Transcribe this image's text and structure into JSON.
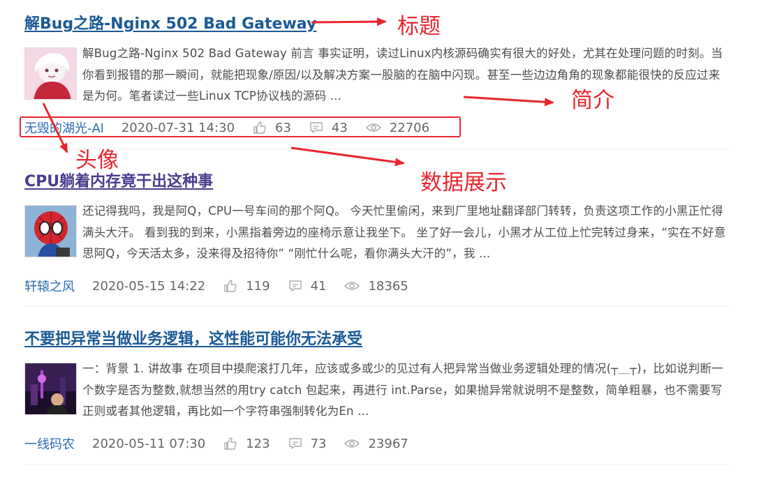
{
  "posts": [
    {
      "title": "解Bug之路-Nginx 502 Bad Gateway",
      "summary": "解Bug之路-Nginx 502 Bad Gateway 前言 事实证明，读过Linux内核源码确实有很大的好处，尤其在处理问题的时刻。当你看到报错的那一瞬间，就能把现象/原因/以及解决方案一股脑的在脑中闪现。甚至一些边边角角的现象都能很快的反应过来是为何。笔者读过一些Linux TCP协议栈的源码 ...",
      "author": "无毁的湖光-Al",
      "date": "2020-07-31 14:30",
      "likes": "63",
      "comments": "43",
      "views": "22706"
    },
    {
      "title": "CPU躺着内存竟干出这种事",
      "summary": "还记得我吗，我是阿Q，CPU一号车间的那个阿Q。 今天忙里偷闲，来到厂里地址翻译部门转转，负责这项工作的小黑正忙得满头大汗。 看到我的到来，小黑指着旁边的座椅示意让我坐下。 坐了好一会儿，小黑才从工位上忙完转过身来，“实在不好意思阿Q，今天活太多，没来得及招待你” “刚忙什么呢，看你满头大汗的”，我 ...",
      "author": "轩辕之风",
      "date": "2020-05-15 14:22",
      "likes": "119",
      "comments": "41",
      "views": "18365"
    },
    {
      "title": "不要把异常当做业务逻辑，这性能可能你无法承受",
      "summary": "一：背景 1. 讲故事 在项目中摸爬滚打几年，应该或多或少的见过有人把异常当做业务逻辑处理的情况(┬＿┬)，比如说判断一个数字是否为整数,就想当然的用try catch 包起来，再进行 int.Parse，如果抛异常就说明不是整数，简单粗暴，也不需要写正则或者其他逻辑，再比如一个字符串强制转化为En ...",
      "author": "一线码农",
      "date": "2020-05-11 07:30",
      "likes": "123",
      "comments": "73",
      "views": "23967"
    }
  ],
  "annotations": {
    "title": "标题",
    "summary": "简介",
    "avatar": "头像",
    "data": "数据展示"
  },
  "colors": {
    "title": "#1a5a96",
    "title_visited": "#4b3b8f",
    "author": "#2c6bb0",
    "annotation": "#e8262e"
  },
  "icons": {
    "likes": "thumbs-up-icon",
    "comments": "comment-icon",
    "views": "eye-icon"
  }
}
